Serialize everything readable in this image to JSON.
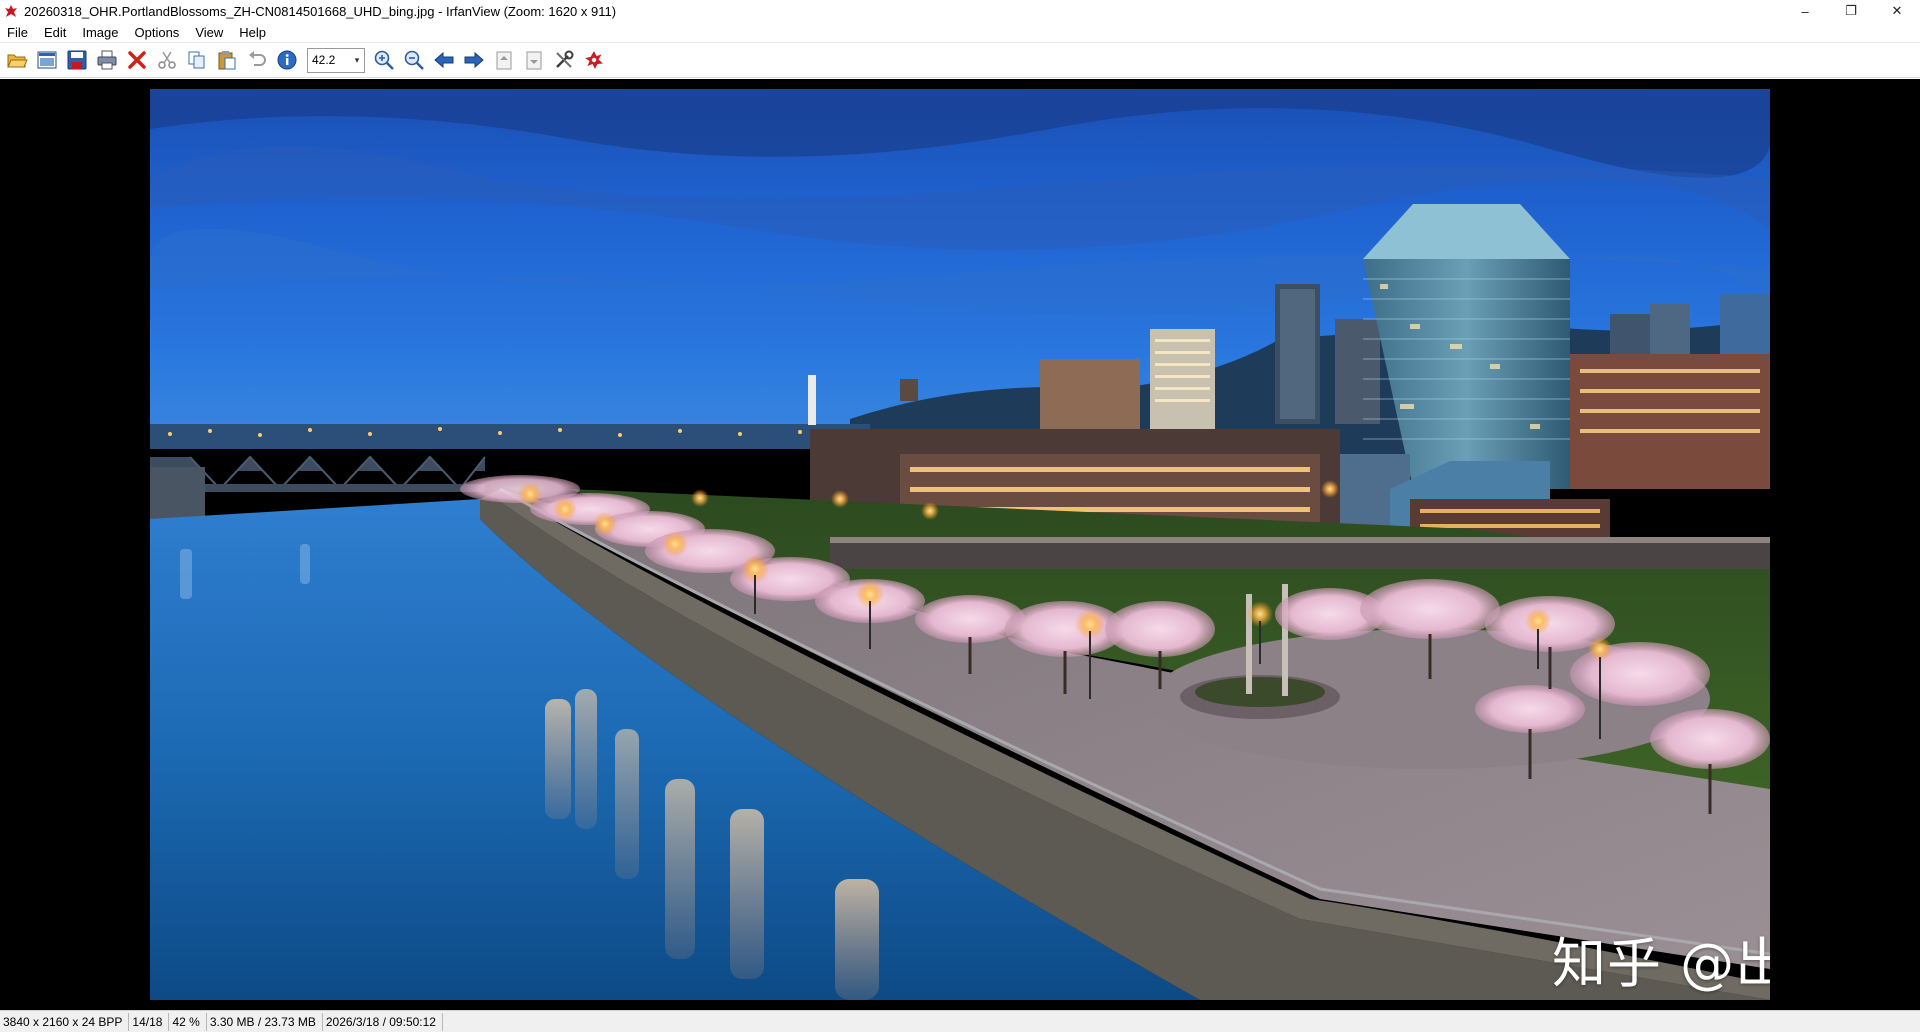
{
  "titlebar": {
    "title": "20260318_OHR.PortlandBlossoms_ZH-CN0814501668_UHD_bing.jpg - IrfanView (Zoom: 1620 x 911)",
    "minimize": "–",
    "maximize": "❐",
    "close": "✕"
  },
  "menu": {
    "items": [
      "File",
      "Edit",
      "Image",
      "Options",
      "View",
      "Help"
    ]
  },
  "toolbar": {
    "zoom_value": "42.2",
    "icons": [
      "open-folder",
      "thumbnails",
      "save",
      "print",
      "delete",
      "cut",
      "copy",
      "paste",
      "undo",
      "info",
      "zoom-in",
      "zoom-out",
      "previous",
      "next",
      "first-page",
      "last-page",
      "settings",
      "irfanview-logo"
    ]
  },
  "image": {
    "watermark": "知乎 @出木杉同学"
  },
  "statusbar": {
    "dimensions": "3840 x 2160 x 24 BPP",
    "index": "14/18",
    "zoom": "42 %",
    "size": "3.30 MB / 23.73 MB",
    "datetime": "2026/3/18 / 09:50:12"
  }
}
